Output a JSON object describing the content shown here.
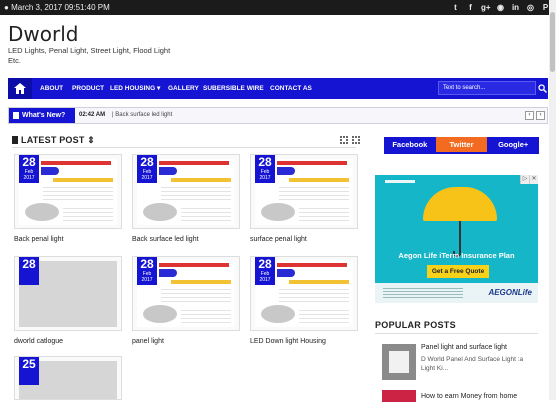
{
  "topbar": {
    "datetime": "March 3, 2017 09:51:40 PM",
    "socials": [
      "twitter-icon",
      "facebook-icon",
      "google-plus-icon",
      "rss-icon",
      "linkedin-icon",
      "instagram-icon",
      "pinterest-icon"
    ],
    "social_glyphs": [
      "t",
      "f",
      "g+",
      "◉",
      "in",
      "◎",
      "P"
    ]
  },
  "site": {
    "title": "Dworld",
    "tagline": "LED Lights, Penal Light, Street Light, Flood Light Etc."
  },
  "nav": {
    "items": [
      "ABOUT",
      "PRODUCT",
      "LED HOUSING ▾",
      "GALLERY",
      "SUBERSIBLE WIRE",
      "CONTACT AS"
    ],
    "search_placeholder": "Text to search...",
    "color": "#1414d2"
  },
  "news": {
    "label": "What's New?",
    "time": "02:42 AM",
    "text": "| Back surface led light"
  },
  "latest": {
    "heading": "LATEST POST ⇕",
    "posts": [
      {
        "day": "28",
        "month": "Feb",
        "year": "2017",
        "title": "Back penal light"
      },
      {
        "day": "28",
        "month": "Feb",
        "year": "2017",
        "title": "Back surface led light"
      },
      {
        "day": "28",
        "month": "Feb",
        "year": "2017",
        "title": "surface penal light"
      },
      {
        "day": "28",
        "month": "",
        "year": "",
        "title": "dworld catlogue"
      },
      {
        "day": "28",
        "month": "Feb",
        "year": "2017",
        "title": "panel light"
      },
      {
        "day": "28",
        "month": "Feb",
        "year": "2017",
        "title": "LED Down light Housing"
      },
      {
        "day": "25",
        "month": "",
        "year": "",
        "title": ""
      }
    ]
  },
  "sidebar": {
    "tabs": [
      "Facebook",
      "Twitter",
      "Google+"
    ],
    "ad": {
      "title": "Aegon Life iTerm Insurance Plan",
      "cta": "Get a Free Quote",
      "logo": "AEGONLife",
      "close": "✕"
    },
    "popular_heading": "POPULAR POSTS",
    "popular": [
      {
        "title": "Panel light and surface light",
        "desc": "D World Panel And Surface Light :a Light  Ki..."
      },
      {
        "title": "How to earn Money from home",
        "desc": ""
      }
    ]
  }
}
